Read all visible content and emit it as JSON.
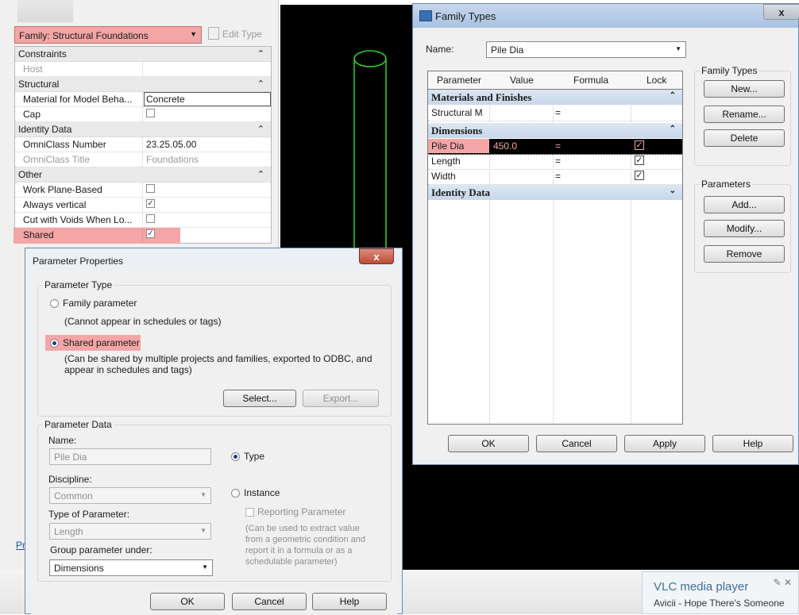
{
  "properties": {
    "family_selector": "Family: Structural Foundations",
    "edit_type": "Edit Type",
    "groups": {
      "constraints": "Constraints",
      "structural": "Structural",
      "identity": "Identity Data",
      "other": "Other"
    },
    "rows": {
      "host": "Host",
      "material_label": "Material for Model Beha...",
      "material_value": "Concrete",
      "cap": "Cap",
      "omniclass_number": "OmniClass Number",
      "omniclass_number_value": "23.25.05.00",
      "omniclass_title": "OmniClass Title",
      "omniclass_title_value": "Foundations",
      "work_plane": "Work Plane-Based",
      "always_vertical": "Always vertical",
      "cut_with_voids": "Cut with Voids When Lo...",
      "shared": "Shared"
    },
    "collapse_glyph": "⌃",
    "link_fragment": "Pr"
  },
  "family_types": {
    "title": "Family Types",
    "close": "x",
    "name_label": "Name:",
    "name_value": "Pile Dia",
    "columns": [
      "Parameter",
      "Value",
      "Formula",
      "Lock"
    ],
    "groups": {
      "materials": "Materials and Finishes",
      "dimensions": "Dimensions",
      "identity": "Identity Data"
    },
    "rows": {
      "structural_m": "Structural M",
      "pile_dia": "Pile Dia",
      "pile_dia_value": "450.0",
      "length": "Length",
      "width": "Width",
      "formula_eq": "="
    },
    "family_types_group": "Family Types",
    "new_button": "New...",
    "rename_button": "Rename...",
    "delete_button": "Delete",
    "parameters_group": "Parameters",
    "add_button": "Add...",
    "modify_button": "Modify...",
    "remove_button": "Remove",
    "ok_button": "OK",
    "cancel_button": "Cancel",
    "apply_button": "Apply",
    "help_button": "Help"
  },
  "parameter_properties": {
    "title": "Parameter Properties",
    "close": "x",
    "param_type_group": "Parameter Type",
    "family_parameter": "Family parameter",
    "family_parameter_note": "(Cannot appear in schedules or tags)",
    "shared_parameter": "Shared parameter",
    "shared_parameter_note_1": "(Can be shared by multiple projects and families, exported to ODBC, and",
    "shared_parameter_note_2": "appear in schedules and tags)",
    "select_button": "Select...",
    "export_button": "Export...",
    "param_data_group": "Parameter Data",
    "name_label": "Name:",
    "name_value": "Pile Dia",
    "type_radio": "Type",
    "discipline_label": "Discipline:",
    "discipline_value": "Common",
    "instance_radio": "Instance",
    "reporting_parameter": "Reporting Parameter",
    "reporting_note_1": "(Can be used to extract value",
    "reporting_note_2": "from a geometric condition and",
    "reporting_note_3": "report it in a formula or as a",
    "reporting_note_4": "schedulable parameter)",
    "type_of_param_label": "Type of Parameter:",
    "type_of_param_value": "Length",
    "group_under_label": "Group parameter under:",
    "group_under_value": "Dimensions",
    "ok_button": "OK",
    "cancel_button": "Cancel",
    "help_button": "Help"
  },
  "vlc": {
    "app": "VLC media player",
    "track": "Avicii - Hope There's Someone",
    "controls": "✎ ✕"
  },
  "colors": {
    "highlight": "#f4a6a6",
    "canvas": "#000000",
    "pile_outline": "#2bd62b"
  }
}
